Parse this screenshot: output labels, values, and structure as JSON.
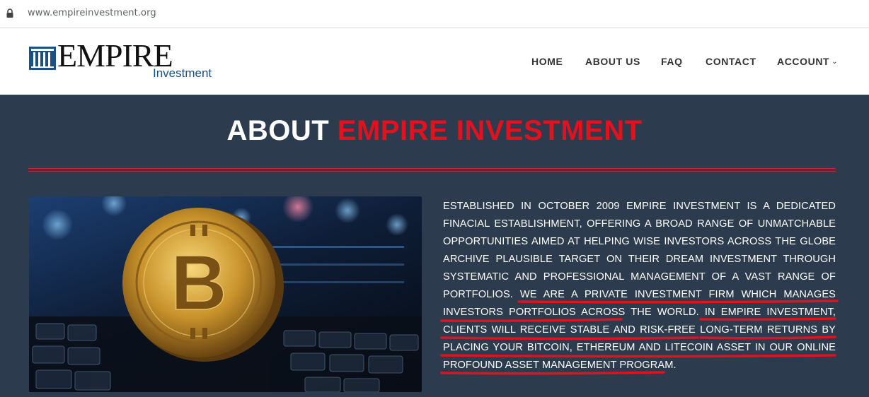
{
  "browser": {
    "url": "www.empireinvestment.org"
  },
  "header": {
    "logo_word": "EMPIRE",
    "logo_sub": "Investment",
    "nav": [
      {
        "label": "HOME"
      },
      {
        "label": "ABOUT US"
      },
      {
        "label": "FAQ"
      },
      {
        "label": "CONTACT"
      },
      {
        "label": "ACCOUNT"
      }
    ]
  },
  "about": {
    "title_white": "ABOUT",
    "title_red": "EMPIRE INVESTMENT",
    "paragraph_part1": "ESTABLISHED IN OCTOBER 2009 EMPIRE INVESTMENT IS A DEDICATED FINACIAL ESTABLISHMENT, OFFERING A BROAD RANGE OF UNMATCHABLE OPPORTUNITIES AIMED AT HELPING WISE INVESTORS ACROSS THE GLOBE ARCHIVE PLAUSIBLE TARGET ON THEIR DREAM INVESTMENT THROUGH SYSTEMATIC AND PROFESSIONAL MANAGEMENT OF A VAST RANGE OF PORTFOLIOS.",
    "paragraph_part2": "WE ARE A PRIVATE INVESTMENT FIRM WHICH MANAGES INVESTORS PORTFOLIOS ACROSS THE WORLD.",
    "paragraph_part3": "IN EMPIRE INVESTMENT, CLIENTS WILL RECEIVE STABLE AND RISK-FREE LONG-TERM RETURNS BY PLACING YOUR BITCOIN, ETHEREUM AND LITECOIN ASSET IN OUR ONLINE PROFOUND ASSET MANAGEMENT PROGRAM.",
    "coin_glyph": "B"
  },
  "colors": {
    "accent_red": "#e3101d",
    "section_bg": "#2c3c4e",
    "annotation_red": "#e3101d",
    "logo_blue": "#1c4f82"
  },
  "icons": {
    "lock": "lock-icon",
    "account_dropdown": "chevron-down-icon",
    "logo_mark": "columns-logo-icon"
  }
}
